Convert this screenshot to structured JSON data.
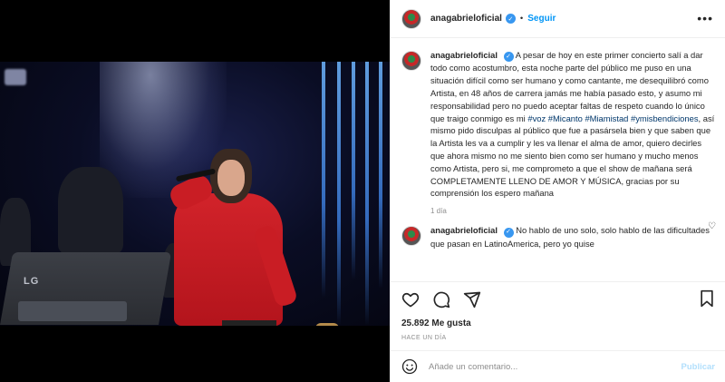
{
  "header": {
    "username": "anagabrieloficial",
    "separator": "•",
    "follow_label": "Seguir",
    "more_label": "•••"
  },
  "caption": {
    "username": "anagabrieloficial",
    "text_part1": "A pesar de hoy en este primer concierto salí a dar todo como acostumbro, esta noche parte del público me puso en una situación difícil como ser humano y como cantante, me desequilibró como Artista, en 48 años de carrera jamás me había pasado esto, y asumo mi responsabilidad pero no puedo aceptar faltas de respeto cuando lo único que traigo conmigo es mi",
    "hashtags": [
      "#voz",
      "#Micanto",
      "#Miamistad",
      "#ymisbendiciones"
    ],
    "text_part2": ", así mismo pido disculpas al público que fue a pasársela bien y que saben que la Artista les va a cumplir y les va llenar el alma de amor, quiero decirles que ahora mismo no me siento bien como ser humano y mucho menos como Artista, pero si, me comprometo a que el show de mañana será COMPLETAMENTE LLENO DE AMOR Y MÚSICA, gracias por su comprensión los espero mañana",
    "age": "1 día"
  },
  "comment2": {
    "username": "anagabrieloficial",
    "text": "No hablo de uno solo, solo hablo de las dificultades que pasan en LatinoAmerica, pero yo quise"
  },
  "photo": {
    "monitor_brand": "LG"
  },
  "actions": {
    "likes": "25.892 Me gusta",
    "timestamp": "Hace un día"
  },
  "add_comment": {
    "placeholder": "Añade un comentario...",
    "publish_label": "Publicar"
  },
  "colors": {
    "link_blue": "#0095f6",
    "hashtag": "#00376b",
    "muted": "#8e8e8e",
    "publish_disabled": "#b2dffc"
  }
}
